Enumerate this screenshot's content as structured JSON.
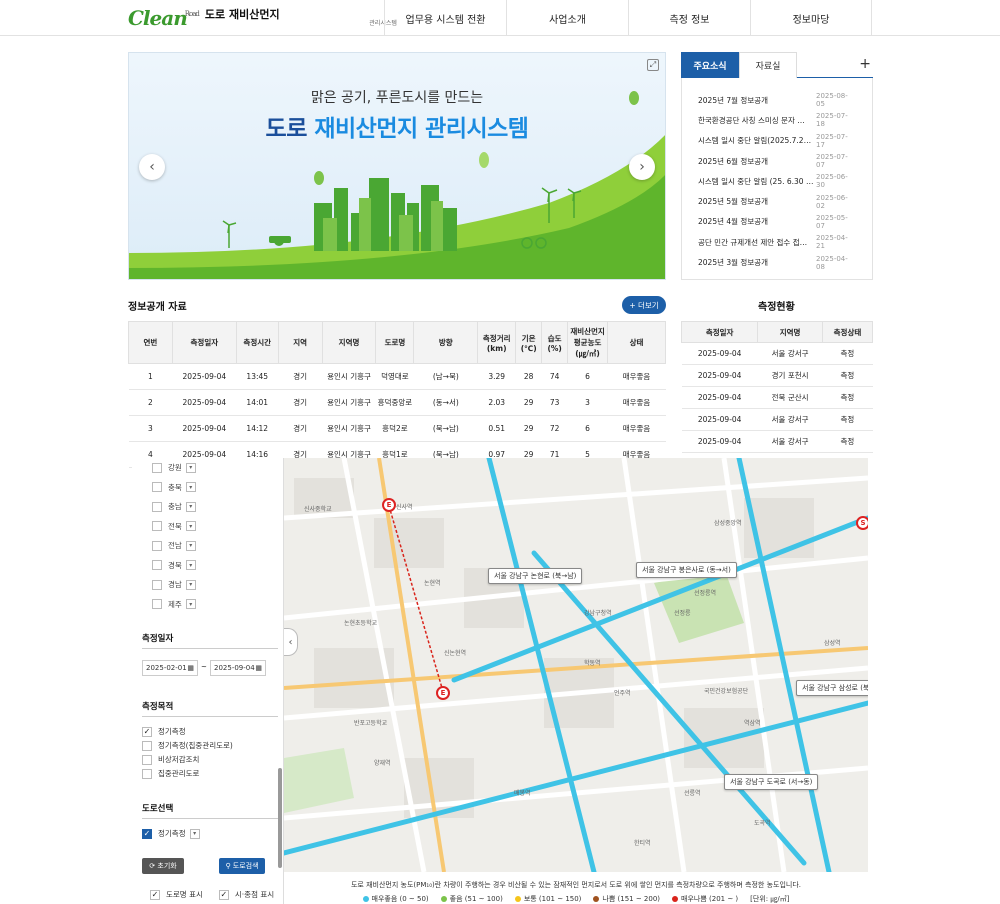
{
  "header": {
    "logo_mark": "Clean",
    "logo_road": "Road",
    "logo_title": "도로 재비산먼지",
    "logo_subtitle": "관리시스템",
    "nav": [
      "업무용 시스템 전환",
      "사업소개",
      "측정 정보",
      "정보마당"
    ]
  },
  "banner": {
    "subtitle": "맑은 공기, 푸른도시를 만드는",
    "title_a": "도로 ",
    "title_b": "재비산먼지 관리시스템"
  },
  "news": {
    "tab_active": "주요소식",
    "tab_other": "자료실",
    "plus": "+",
    "items": [
      {
        "title": "2025년 7월 정보공개",
        "date": "2025-08-05"
      },
      {
        "title": "한국환경공단 사칭 스미싱 문자 …",
        "date": "2025-07-18"
      },
      {
        "title": "시스템 일시 중단 알림(2025.7.2…",
        "date": "2025-07-17"
      },
      {
        "title": "2025년 6월 정보공개",
        "date": "2025-07-07"
      },
      {
        "title": "시스템 일시 중단 알림 (25. 6.30 …",
        "date": "2025-06-30"
      },
      {
        "title": "2025년 5월 정보공개",
        "date": "2025-06-02"
      },
      {
        "title": "2025년 4월 정보공개",
        "date": "2025-05-07"
      },
      {
        "title": "공단 민간 규제개선 제안 접수 접…",
        "date": "2025-04-21"
      },
      {
        "title": "2025년 3월 정보공개",
        "date": "2025-04-08"
      }
    ]
  },
  "info": {
    "title": "정보공개 자료",
    "more": "+ 더보기",
    "headers": [
      "연번",
      "측정일자",
      "측정시간",
      "지역",
      "지역명",
      "도로명",
      "방향",
      "측정거리 (km)",
      "기온 (℃)",
      "습도 (%)",
      "재비산먼지 평균농도 (㎍/㎥)",
      "상태"
    ],
    "rows": [
      [
        "1",
        "2025-09-04",
        "13:45",
        "경기",
        "용인시 기흥구",
        "덕영대로",
        "(남→북)",
        "3.29",
        "28",
        "74",
        "6",
        "매우좋음"
      ],
      [
        "2",
        "2025-09-04",
        "14:01",
        "경기",
        "용인시 기흥구",
        "흥덕중앙로",
        "(동→서)",
        "2.03",
        "29",
        "73",
        "3",
        "매우좋음"
      ],
      [
        "3",
        "2025-09-04",
        "14:12",
        "경기",
        "용인시 기흥구",
        "흥덕2로",
        "(북→남)",
        "0.51",
        "29",
        "72",
        "6",
        "매우좋음"
      ],
      [
        "4",
        "2025-09-04",
        "14:16",
        "경기",
        "용인시 기흥구",
        "흥덕1로",
        "(북→남)",
        "0.97",
        "29",
        "71",
        "5",
        "매우좋음"
      ]
    ]
  },
  "status": {
    "title": "측정현황",
    "headers": [
      "측정일자",
      "지역명",
      "측정상태"
    ],
    "rows": [
      [
        "2025-09-04",
        "서울 강서구",
        "측정"
      ],
      [
        "2025-09-04",
        "경기 포천시",
        "측정"
      ],
      [
        "2025-09-04",
        "전북 군산시",
        "측정"
      ],
      [
        "2025-09-04",
        "서울 강서구",
        "측정"
      ],
      [
        "2025-09-04",
        "서울 강서구",
        "측정"
      ]
    ]
  },
  "panel": {
    "regions": [
      "강원",
      "충북",
      "충남",
      "전북",
      "전남",
      "경북",
      "경남",
      "제주"
    ],
    "date_title": "측정일자",
    "date_from": "2025-02-01",
    "date_sep": "~",
    "date_to": "2025-09-04",
    "purpose_title": "측정목적",
    "purposes": [
      {
        "label": "정기측정",
        "checked": true
      },
      {
        "label": "정기측정(집중관리도로)",
        "checked": false
      },
      {
        "label": "비상저감조치",
        "checked": false
      },
      {
        "label": "집중관리도로",
        "checked": false
      }
    ],
    "road_title": "도로선택",
    "road_value": "정기측정",
    "reset": "초기화",
    "search": "도로검색",
    "opt1": "도로명 표시",
    "opt2": "시·종점 표시"
  },
  "map": {
    "labels": [
      "서울 강남구 논현로 (북→남)",
      "서울 강남구 봉은사로 (동→서)",
      "서울 강남구 삼성로 (북",
      "서울 강남구 도곡로 (서→동)"
    ],
    "pois": [
      "신사역",
      "논현역",
      "학동역",
      "강남구청역",
      "신논현역",
      "언주역",
      "선정릉역",
      "삼성중앙역",
      "역삼역",
      "선릉역",
      "한티역",
      "도곡역",
      "양재역",
      "매봉역",
      "삼성역",
      "신사중학교",
      "반포고등학교",
      "논현초등학교",
      "선정릉",
      "국민건강보험공단"
    ]
  },
  "legend": {
    "text": "도로 재비산먼지 농도(PM₁₀)란 차량이 주행하는 경우 비산될 수 있는 잠재적인 먼지로서 도로 위에 쌓인 먼지를 측정차량으로 주행하며 측정한 농도입니다.",
    "items": [
      {
        "label": "매우좋음 (0 ~ 50)",
        "color": "#3fc3e6"
      },
      {
        "label": "좋음 (51 ~ 100)",
        "color": "#7cc34a"
      },
      {
        "label": "보통 (101 ~ 150)",
        "color": "#f5c51b"
      },
      {
        "label": "나쁨 (151 ~ 200)",
        "color": "#a0521f"
      },
      {
        "label": "매우나쁨 (201 ~ )",
        "color": "#d9241b"
      }
    ],
    "unit": "[단위: ㎍/㎥]"
  }
}
